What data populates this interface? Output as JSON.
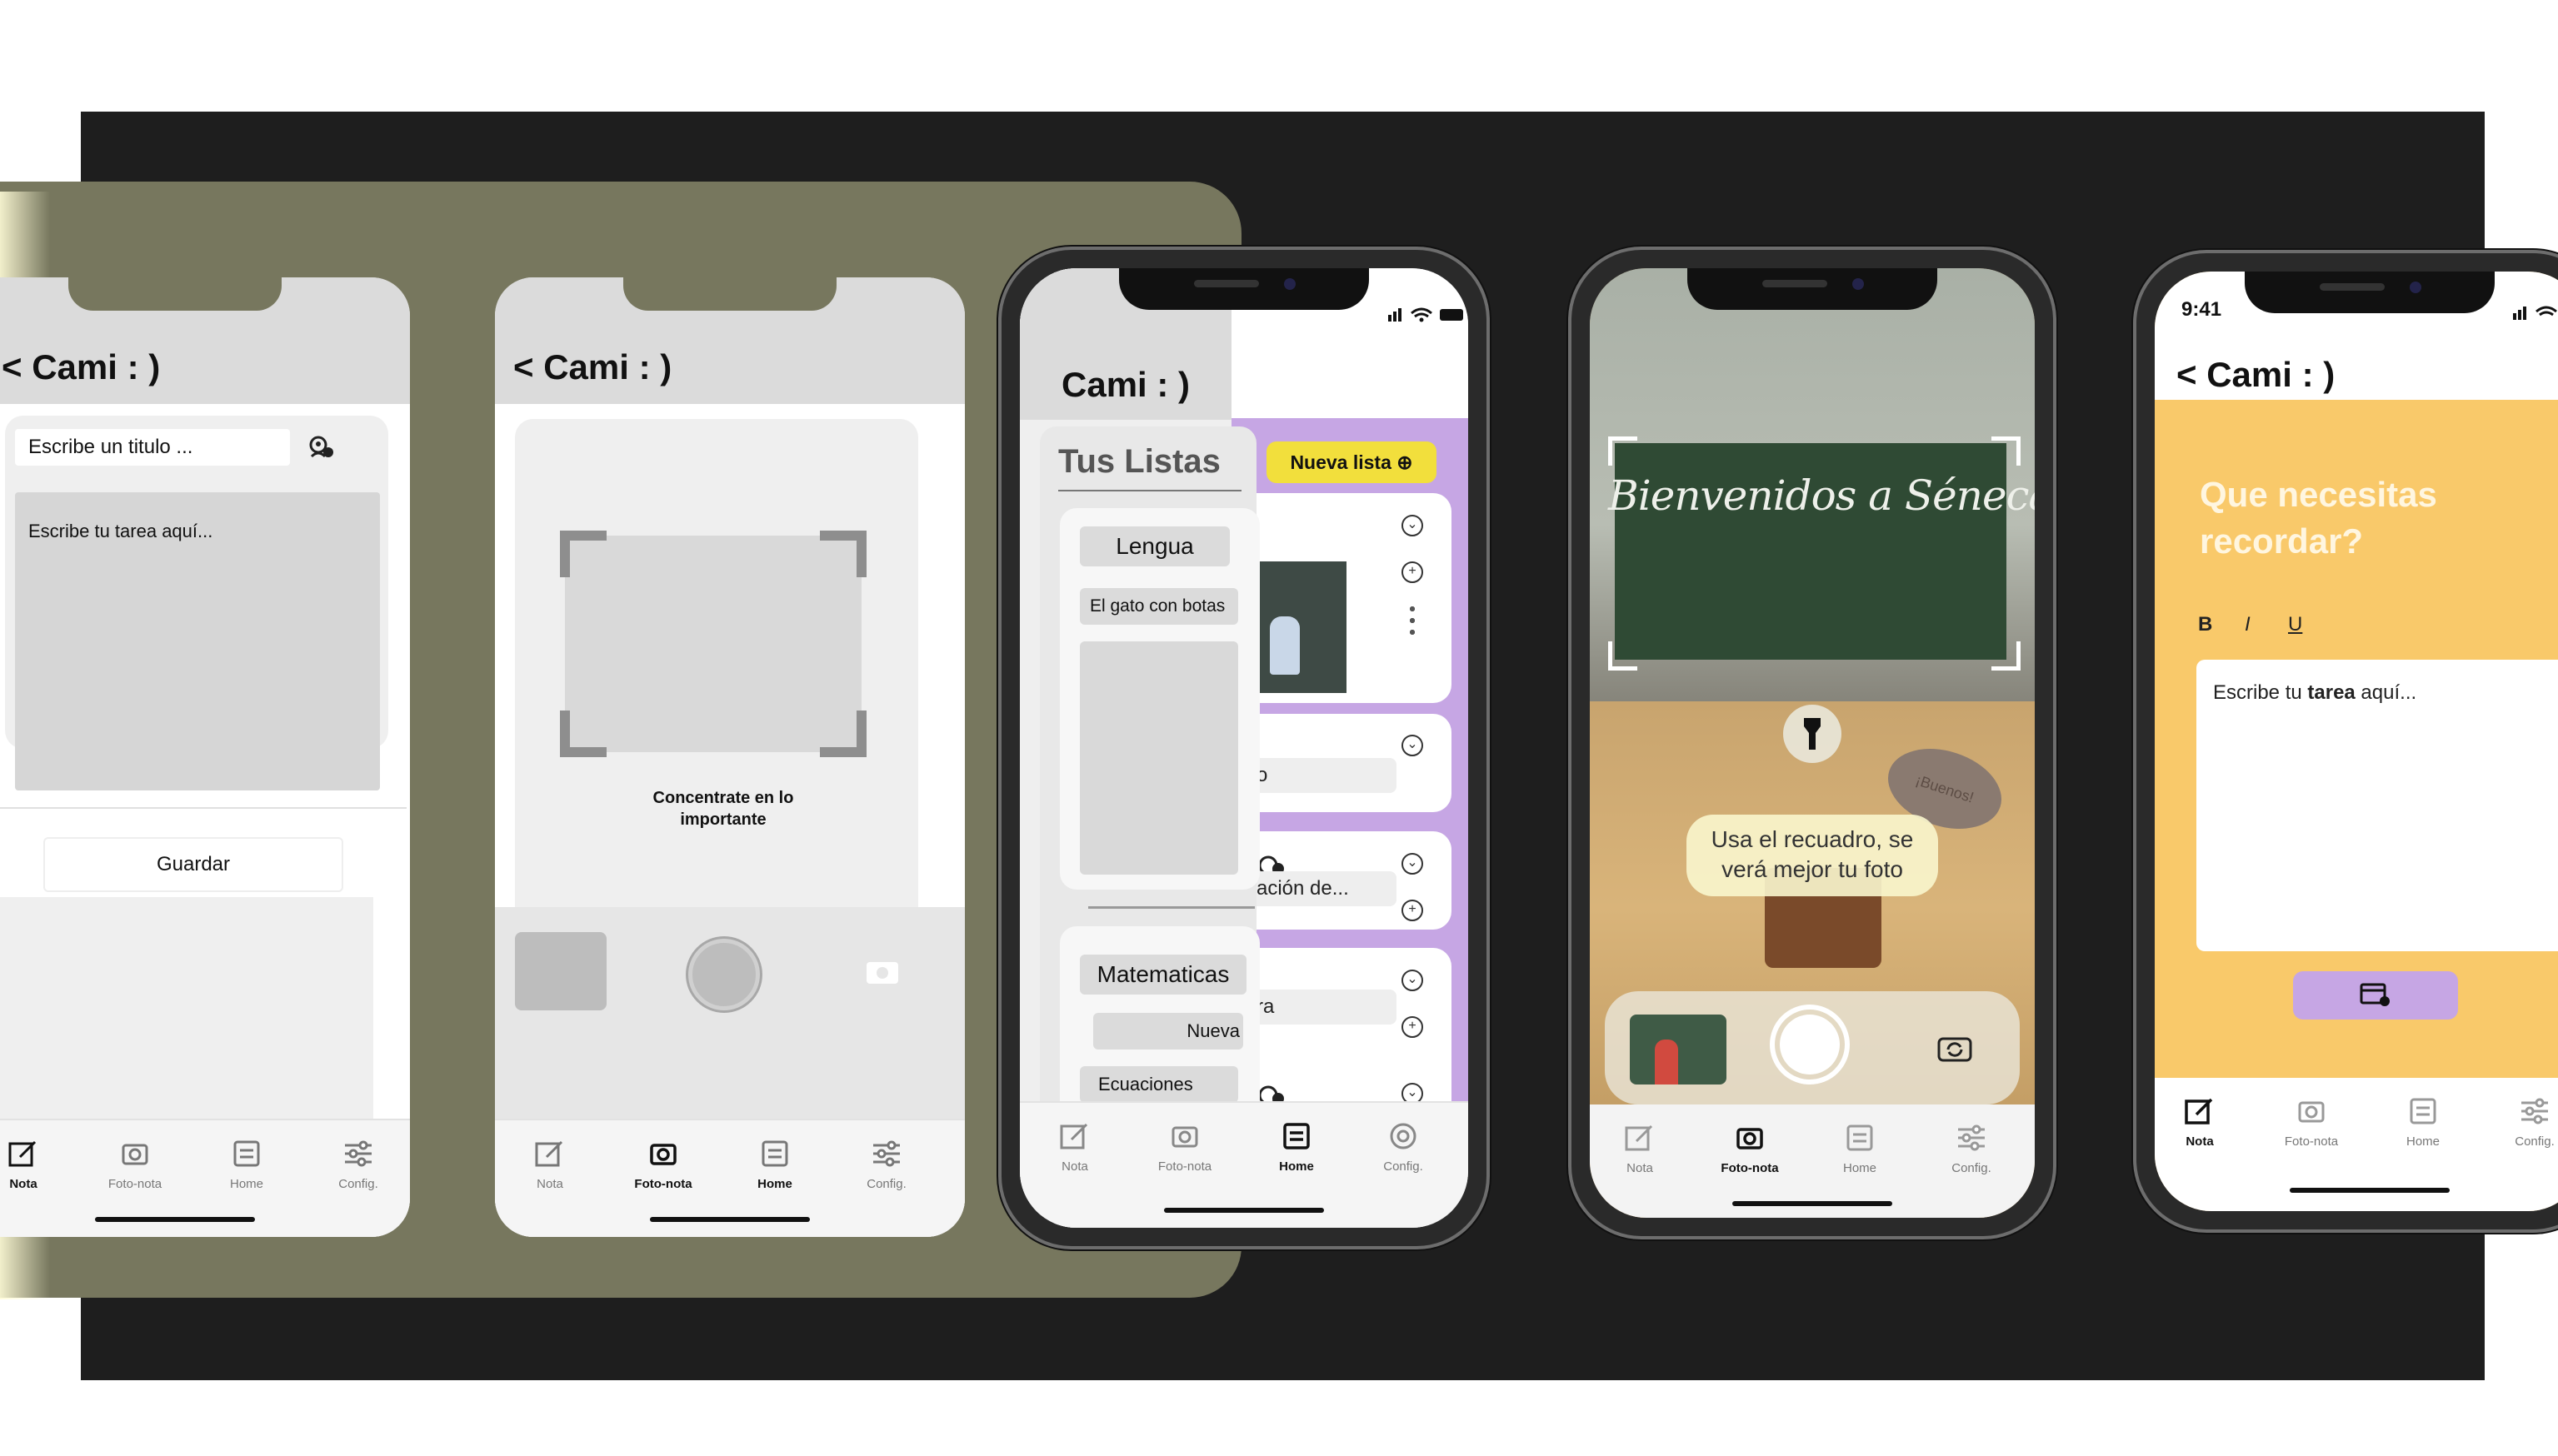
{
  "app": {
    "header_title": "Cami : )",
    "tabs": [
      "Nota",
      "Foto-nota",
      "Home",
      "Config."
    ]
  },
  "wireframe_note": {
    "title_placeholder": "Escribe un titulo ...",
    "task_placeholder": "Escribe tu tarea aquí...",
    "save_label": "Guardar"
  },
  "wireframe_camera": {
    "hint": "Concentrate en lo importante"
  },
  "home": {
    "status_time": "",
    "section_title": "Tus Listas",
    "new_list_label": "Nueva lista",
    "lists": [
      {
        "name": "Lengua",
        "item": "El gato con botas"
      },
      {
        "name": "Matematicas",
        "item": "Ecuaciones",
        "extra": "Nueva"
      }
    ],
    "partial_items": [
      "o",
      "ación de...",
      "ra"
    ]
  },
  "camera": {
    "chalkboard_text": "Bienvenidos a Séneca",
    "hint": "Usa el recuadro, se verá mejor tu foto",
    "sign_text": "¡Buenos!"
  },
  "note": {
    "status_time": "9:41",
    "prompt": "Que necesitas recordar?",
    "format_buttons": [
      "B",
      "I",
      "U"
    ],
    "task_placeholder_prefix": "Escribe tu ",
    "task_placeholder_bold": "tarea",
    "task_placeholder_suffix": " aquí..."
  },
  "colors": {
    "olive": "#77775e",
    "purple": "#c6a6e4",
    "yellow_button": "#f2df3c",
    "note_yellow": "#f9c96a",
    "chalkboard": "#2f4a34"
  }
}
